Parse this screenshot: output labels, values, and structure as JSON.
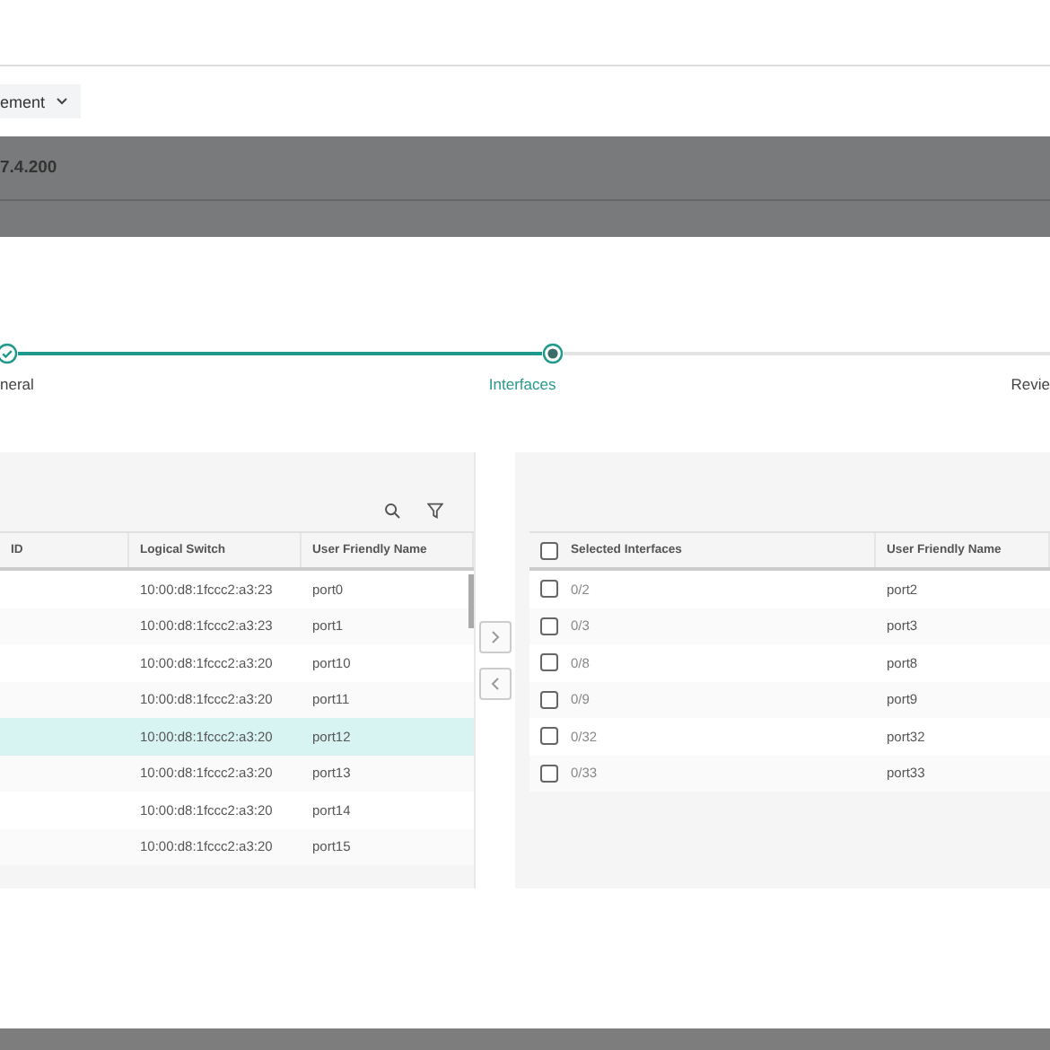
{
  "dropdown": {
    "label": "ement"
  },
  "banner": {
    "title": "7.4.200"
  },
  "steps": [
    {
      "label": "neral",
      "kind": "done"
    },
    {
      "label": "Interfaces",
      "kind": "current"
    },
    {
      "label": "Revie",
      "kind": "todo"
    }
  ],
  "available": {
    "columns": [
      "ID",
      "Logical Switch",
      "User Friendly Name"
    ],
    "rows": [
      {
        "switch": "10:00:d8:1fccc2:a3:23",
        "name": "port0",
        "selected": false
      },
      {
        "switch": "10:00:d8:1fccc2:a3:23",
        "name": "port1",
        "selected": false
      },
      {
        "switch": "10:00:d8:1fccc2:a3:20",
        "name": "port10",
        "selected": false
      },
      {
        "switch": "10:00:d8:1fccc2:a3:20",
        "name": "port11",
        "selected": false
      },
      {
        "switch": "10:00:d8:1fccc2:a3:20",
        "name": "port12",
        "selected": true
      },
      {
        "switch": "10:00:d8:1fccc2:a3:20",
        "name": "port13",
        "selected": false
      },
      {
        "switch": "10:00:d8:1fccc2:a3:20",
        "name": "port14",
        "selected": false
      },
      {
        "switch": "10:00:d8:1fccc2:a3:20",
        "name": "port15",
        "selected": false
      }
    ]
  },
  "chosen": {
    "columns": [
      "Selected Interfaces",
      "User Friendly Name"
    ],
    "all_checked": false,
    "rows": [
      {
        "interface": "0/2",
        "name": "port2",
        "checked": false
      },
      {
        "interface": "0/3",
        "name": "port3",
        "checked": false
      },
      {
        "interface": "0/8",
        "name": "port8",
        "checked": false
      },
      {
        "interface": "0/9",
        "name": "port9",
        "checked": false
      },
      {
        "interface": "0/32",
        "name": "port32",
        "checked": false
      },
      {
        "interface": "0/33",
        "name": "port33",
        "checked": false
      }
    ]
  }
}
